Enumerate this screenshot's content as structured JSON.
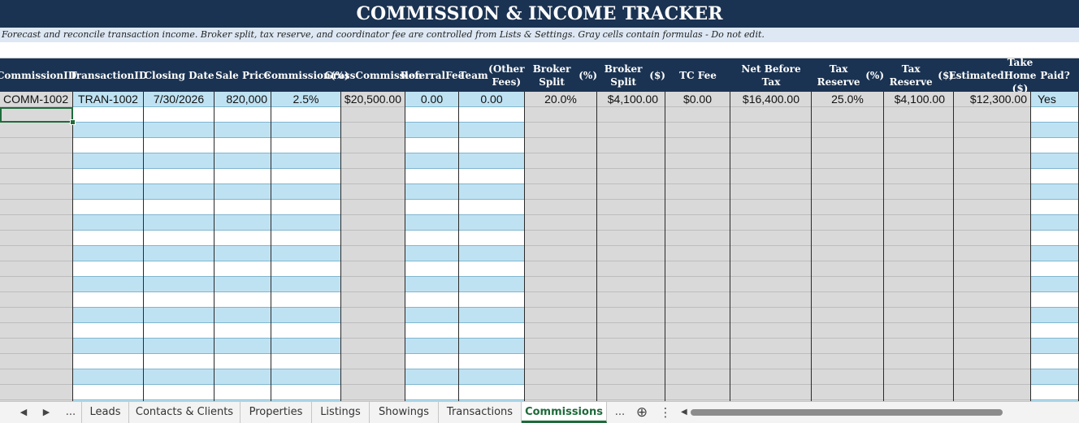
{
  "sheet": {
    "title": "COMMISSION & INCOME TRACKER",
    "subtitle": "Forecast and reconcile transaction income. Broker split, tax reserve, and coordinator fee are controlled from Lists & Settings. Gray cells contain formulas - Do not edit."
  },
  "table": {
    "headers": [
      [
        "Commission",
        "ID"
      ],
      [
        "Transaction",
        "ID"
      ],
      [
        "Closing Date"
      ],
      [
        "Sale Price"
      ],
      [
        "Commission",
        "(%)"
      ],
      [
        "Gross",
        "Commission"
      ],
      [
        "Referral",
        "Fee"
      ],
      [
        "Team",
        "(Other Fees)"
      ],
      [
        "Broker Split",
        "(%)"
      ],
      [
        "Broker Split",
        "($)"
      ],
      [
        "TC Fee"
      ],
      [
        "Net Before Tax"
      ],
      [
        "Tax Reserve",
        "(%)"
      ],
      [
        "Tax Reserve",
        "($)"
      ],
      [
        "Estimated",
        "Take Home ($)"
      ],
      [
        "Paid?"
      ]
    ],
    "rows": [
      [
        "COMM-1002",
        "TRAN-1002",
        "7/30/2026",
        "820,000",
        "2.5%",
        "$20,500.00",
        "0.00",
        "0.00",
        "20.0%",
        "$4,100.00",
        "$0.00",
        "$16,400.00",
        "25.0%",
        "$4,100.00",
        "$12,300.00",
        "Yes"
      ]
    ]
  },
  "tabs": {
    "nav_prev": "◀",
    "nav_next": "▶",
    "ellipsis_left": "...",
    "items": [
      "Leads",
      "Contacts & Clients",
      "Properties",
      "Listings",
      "Showings",
      "Transactions",
      "Commissions"
    ],
    "active": "Commissions",
    "ellipsis_right": "...",
    "add_symbol": "⊕",
    "menu_symbol": "⋮",
    "scroll_left": "◀"
  },
  "colors": {
    "header_bg": "#1b3352",
    "stripe_blue": "#bfe2f2",
    "formula_gray": "#d9d9d9",
    "active_tab": "#1e6b3a"
  }
}
